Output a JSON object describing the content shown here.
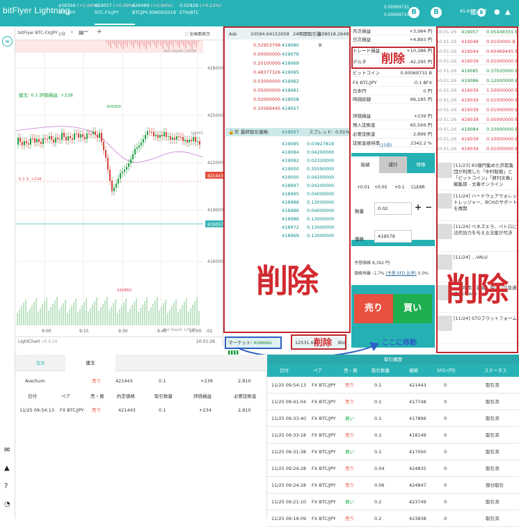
{
  "app": {
    "logo": "bitFlyer Lightning"
  },
  "tickers": [
    {
      "price": "426356",
      "change": "(+1.06%)",
      "symbol": "BTC/JPY",
      "active": false
    },
    {
      "price": "419057",
      "change": "(+0.69%)",
      "symbol": "BTC-FX/JPY",
      "active": true
    },
    {
      "price": "426499",
      "change": "(+0.84%)",
      "symbol": "BTCJPY-30NOV2018",
      "active": false
    },
    {
      "price": "0.02928",
      "change": "(+0.23%)",
      "symbol": "ETH/BTC",
      "active": false
    }
  ],
  "balances": [
    "0.00069731",
    "0.00069731"
  ],
  "user": {
    "label": "65,603"
  },
  "chart": {
    "title": "bitFlyer BTC-FX/JPY",
    "interval": "1分",
    "fullscreen_label": "全画面表示",
    "ask_depth_label": "Ask Depth 10599",
    "bid_depth_label": "Bid Depth 12538",
    "position_label": "建玉: 0.1  評価損益: +238",
    "high_label": "426000",
    "low_label": "415850",
    "pos_line_label": "0.1 S, +238",
    "yaxis": [
      "428000",
      "425000",
      "422000",
      "419000",
      "416000"
    ],
    "last_price_badge": "421443",
    "current_price_badge": "419057",
    "volume_label": "10449",
    "xaxis": [
      "9:00",
      "9:15",
      "9:30",
      "9:45",
      "10:00",
      ":01"
    ],
    "footer_left": "LightChart",
    "footer_version": "v6.4.29",
    "footer_time": "10:01:26"
  },
  "orderbook": {
    "ask_label": "Ask",
    "ask_total": "10594.64153058",
    "volume_label": "24時間取引量:",
    "volume_value": "538018.2648 B",
    "asks": [
      {
        "qty": "0.52953798",
        "price": "419080"
      },
      {
        "qty": "0.00000000",
        "price": "419076"
      },
      {
        "qty": "0.20100000",
        "price": "419069"
      },
      {
        "qty": "0.48377326",
        "price": "419065"
      },
      {
        "qty": "0.03000000",
        "price": "419062"
      },
      {
        "qty": "0.05000000",
        "price": "419061"
      },
      {
        "qty": "0.02000000",
        "price": "419058"
      },
      {
        "qty": "0.10569445",
        "price": "419057"
      }
    ],
    "last_label": "最終取引価格:",
    "last_value": "419057",
    "spread_label": "スプレッド:",
    "spread_value": "0.01%",
    "bids": [
      {
        "price": "419085",
        "qty": "0.03827819"
      },
      {
        "price": "419084",
        "qty": "0.04200000"
      },
      {
        "price": "419082",
        "qty": "0.02320000"
      },
      {
        "price": "419000",
        "qty": "0.35590000"
      },
      {
        "price": "419000",
        "qty": "0.04200000"
      },
      {
        "price": "418997",
        "qty": "0.04200000"
      },
      {
        "price": "418995",
        "qty": "0.04000000"
      },
      {
        "price": "418988",
        "qty": "0.13000000"
      },
      {
        "price": "418986",
        "qty": "0.04000000"
      },
      {
        "price": "418986",
        "qty": "0.13000000"
      },
      {
        "price": "418972",
        "qty": "0.13000000"
      },
      {
        "price": "418969",
        "qty": "0.13000000"
      }
    ],
    "market_label": "マーケット:",
    "market_status": "RUNNING",
    "bid_total": "12531.64",
    "bid_unit": "Btd"
  },
  "info": {
    "rows": [
      {
        "label": "月次損益",
        "value": "+3,984 円"
      },
      {
        "label": "日次損益",
        "value": "+4,893 円"
      },
      {
        "label": "トレード損益",
        "value": "+10,386 円"
      },
      {
        "label": "デルタ",
        "value": "-42,295 円"
      },
      {
        "label": "ビットコイン",
        "value": "0.00069731 B"
      },
      {
        "label": "FX BTC/JPY",
        "value": "-0.1 BFX"
      },
      {
        "label": "日本円",
        "value": "0 円"
      },
      {
        "label": "時価総額",
        "value": "66,185 円"
      },
      {
        "label": "評価損益",
        "value": "+239 円"
      },
      {
        "label": "預入証拠金",
        "value": "65,569 円"
      },
      {
        "label": "必要証拠金",
        "value": "2,899 円"
      },
      {
        "label": "証拠金維持率",
        "value": "2342.2 %"
      }
    ],
    "leverage_note": "(15倍)"
  },
  "trade": {
    "tabs": [
      "指値",
      "成行",
      "特殊"
    ],
    "qty_buttons": [
      "+0.01",
      "+0.05",
      "+0.1",
      "CLEAR"
    ],
    "qty_label": "数量",
    "qty_value": "0.02",
    "price_label": "価格",
    "price_value": "419579",
    "est_label": "予想価格",
    "est_value": "8,392 円",
    "dev_label": "価格乖離",
    "dev_value": "-1.7%",
    "sfd_label": "(予想 SFD 比率)",
    "sfd_value": "0.0%",
    "sell_label": "売り",
    "buy_label": "買い"
  },
  "ticker_list": [
    {
      "time": "10:01:26",
      "price": "419057",
      "size": "0.05438355 B",
      "side": "buy"
    },
    {
      "time": "10:01:26",
      "price": "419048",
      "size": "0.0150000 B",
      "side": "sell"
    },
    {
      "time": "10:01:26",
      "price": "419044",
      "size": "0.60469445 B",
      "side": "sell"
    },
    {
      "time": "10:01:26",
      "price": "419039",
      "size": "0.01000000 B",
      "side": "sell"
    },
    {
      "time": "10:01:26",
      "price": "419085",
      "size": "0.37020000 B",
      "side": "buy"
    },
    {
      "time": "10:01:26",
      "price": "419086",
      "size": "0.12000000 B",
      "side": "buy"
    },
    {
      "time": "10:01:26",
      "price": "419039",
      "size": "1.50000000 B",
      "side": "sell"
    },
    {
      "time": "10:01:26",
      "price": "419039",
      "size": "0.01000000 B",
      "side": "sell"
    },
    {
      "time": "10:01:26",
      "price": "419039",
      "size": "0.01000000 B",
      "side": "sell"
    },
    {
      "time": "10:01:26",
      "price": "419039",
      "size": "0.05000000 B",
      "side": "sell"
    },
    {
      "time": "10:01:26",
      "price": "419084",
      "size": "0.10000000 B",
      "side": "buy"
    },
    {
      "time": "10:01:26",
      "price": "419039",
      "size": "0.10000000 B",
      "side": "sell"
    },
    {
      "time": "10:01:26",
      "price": "419039",
      "size": "0.01000000 B",
      "side": "sell"
    }
  ],
  "news": [
    {
      "text": "[11/23] 83億円集めた詐欺集団が利用した「中村聡樹」と「ビットコイン」「週刊文春」編集部 - 文春オンライン"
    },
    {
      "text": "[11/24] ハードウェアウォレットレッジャー、BCHのサポートを再開"
    },
    {
      "text": "[11/24] ベネズエラ、ペトロに法的効力を与える法案が可決"
    },
    {
      "text": "[11/24] …VALU"
    },
    {
      "text": "…準利用が激減、遠い「IT普通盛」(WAU)"
    },
    {
      "text": "[11/24] STOプラットフォーム"
    }
  ],
  "annotations": {
    "delete": "削除",
    "move_here": "ここに移動"
  },
  "positions": {
    "tabs": [
      "注文",
      "建玉"
    ],
    "summary": {
      "label": "Ave/Sum",
      "side": "売り",
      "price": "421443",
      "qty": "0.1",
      "pnl": "+239",
      "margin": "2,810"
    },
    "headers": [
      "日付",
      "ペア",
      "売・買",
      "約定価格",
      "取引数量",
      "評価損益",
      "必要証拠金"
    ],
    "rows": [
      {
        "date": "11/25 09:54:13",
        "pair": "FX BTC/JPY",
        "side": "売り",
        "price": "421443",
        "qty": "0.1",
        "pnl": "+234",
        "margin": "2,810"
      }
    ]
  },
  "history": {
    "title": "取引履歴",
    "headers": [
      "日付",
      "ペア",
      "売・買",
      "取引数量",
      "価格",
      "SFD (円)",
      "ステータス"
    ],
    "rows": [
      {
        "date": "11/25 09:54:13",
        "pair": "FX BTC/JPY",
        "side": "売り",
        "qty": "0.1",
        "price": "421443",
        "sfd": "0",
        "status": "取引済"
      },
      {
        "date": "11/25 09:41:04",
        "pair": "FX BTC/JPY",
        "side": "売り",
        "qty": "0.1",
        "price": "417748",
        "sfd": "0",
        "status": "取引済"
      },
      {
        "date": "11/25 09:33:40",
        "pair": "FX BTC/JPY",
        "side": "買い",
        "qty": "0.1",
        "price": "417896",
        "sfd": "0",
        "status": "取引済"
      },
      {
        "date": "11/25 09:33:18",
        "pair": "FX BTC/JPY",
        "side": "売り",
        "qty": "0.1",
        "price": "418149",
        "sfd": "0",
        "status": "取引済"
      },
      {
        "date": "11/25 09:31:38",
        "pair": "FX BTC/JPY",
        "side": "買い",
        "qty": "0.1",
        "price": "417000",
        "sfd": "0",
        "status": "取引済"
      },
      {
        "date": "11/25 09:24:28",
        "pair": "FX BTC/JPY",
        "side": "売り",
        "qty": "0.04",
        "price": "424835",
        "sfd": "0",
        "status": "取引済"
      },
      {
        "date": "11/25 09:24:28",
        "pair": "FX BTC/JPY",
        "side": "売り",
        "qty": "0.06",
        "price": "424847",
        "sfd": "0",
        "status": "部分取引"
      },
      {
        "date": "11/25 09:21:10",
        "pair": "FX BTC/JPY",
        "side": "買い",
        "qty": "0.2",
        "price": "423749",
        "sfd": "0",
        "status": "取引済"
      },
      {
        "date": "11/25 09:19:09",
        "pair": "FX BTC/JPY",
        "side": "売り",
        "qty": "0.2",
        "price": "423838",
        "sfd": "0",
        "status": "取引済"
      }
    ]
  },
  "colors": {
    "brand": "#27b3b6",
    "sell": "#e8503f",
    "buy": "#1fae4f",
    "annotation_red": "#c0252b",
    "annotation_blue": "#2c5fc4"
  }
}
